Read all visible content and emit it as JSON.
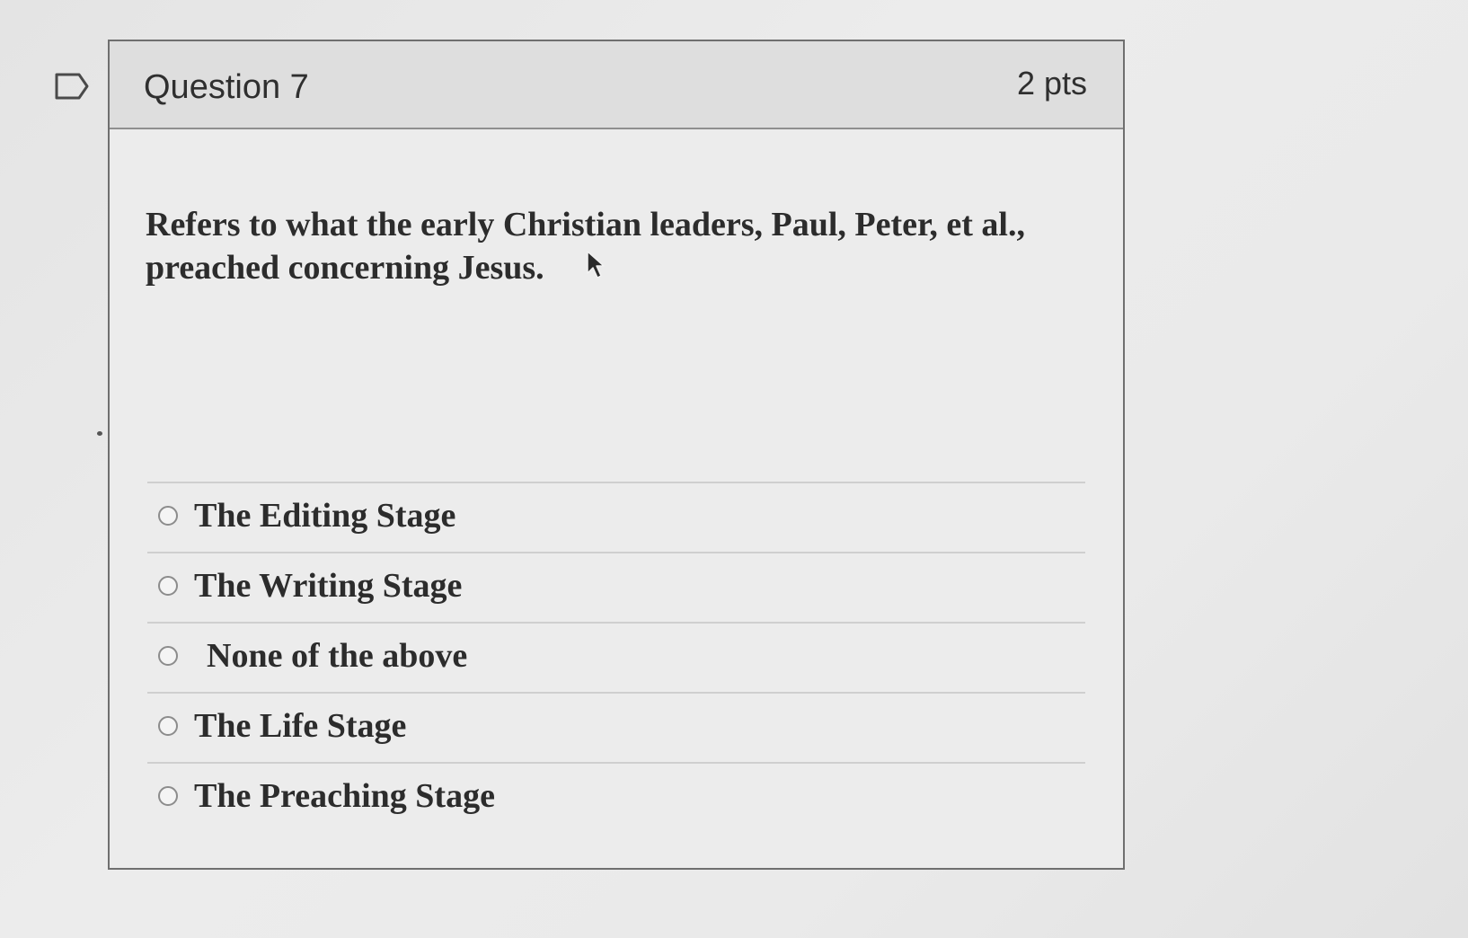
{
  "question": {
    "title": "Question 7",
    "points": "2 pts",
    "text": "Refers to what the early Christian leaders, Paul, Peter, et al., preached concerning Jesus."
  },
  "answers": [
    {
      "label": "The Editing Stage",
      "selected": false
    },
    {
      "label": "The Writing Stage",
      "selected": false
    },
    {
      "label": "None of the above",
      "selected": false
    },
    {
      "label": "The Life Stage",
      "selected": false
    },
    {
      "label": "The Preaching Stage",
      "selected": false
    }
  ],
  "icons": {
    "flag": "flag-icon",
    "cursor": "mouse-cursor-icon"
  }
}
